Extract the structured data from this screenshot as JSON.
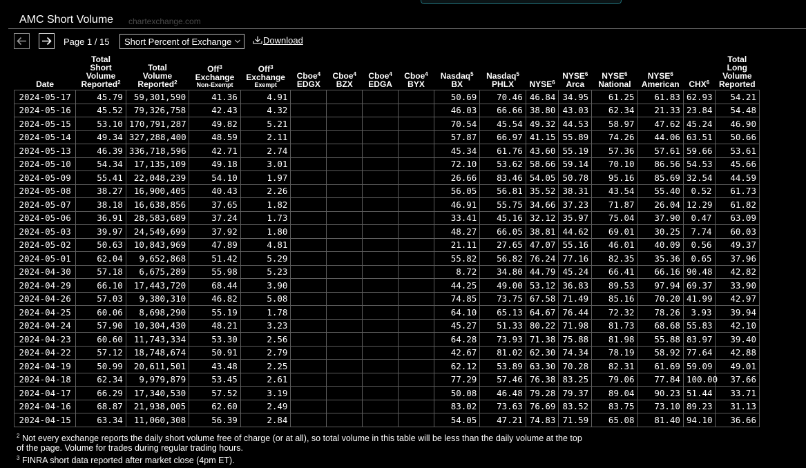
{
  "header": {
    "title": "AMC Short Volume",
    "watermark": "chartexchange.com"
  },
  "controls": {
    "page_label": "Page 1 / 15",
    "select_value": "Short Percent of Exchange",
    "download_label": "Download"
  },
  "columns": [
    {
      "lines": [
        "Total",
        "Short",
        "Volume",
        "Reported"
      ],
      "sup": "2",
      "small": ""
    },
    {
      "lines": [
        "Total",
        "Short",
        "Volume",
        "Reported"
      ],
      "sup": "2",
      "small": ""
    },
    {
      "lines": [
        "Off",
        "Exchange"
      ],
      "sup": "3",
      "small": "Non-Exempt"
    },
    {
      "lines": [
        "Off",
        "Exchange"
      ],
      "sup": "3",
      "small": "Exempt"
    },
    {
      "lines": [
        "Cboe",
        "EDGX"
      ],
      "sup": "4",
      "small": ""
    },
    {
      "lines": [
        "Cboe",
        "BZX"
      ],
      "sup": "4",
      "small": ""
    },
    {
      "lines": [
        "Cboe",
        "EDGA"
      ],
      "sup": "4",
      "small": ""
    },
    {
      "lines": [
        "Cboe",
        "BYX"
      ],
      "sup": "4",
      "small": ""
    },
    {
      "lines": [
        "Nasdaq",
        "BX"
      ],
      "sup": "5",
      "small": ""
    },
    {
      "lines": [
        "Nasdaq",
        "PHLX"
      ],
      "sup": "5",
      "small": ""
    },
    {
      "lines": [
        "NYSE"
      ],
      "sup": "6",
      "small": ""
    },
    {
      "lines": [
        "NYSE",
        "Arca"
      ],
      "sup": "6",
      "small": ""
    },
    {
      "lines": [
        "NYSE",
        "National"
      ],
      "sup": "6",
      "small": ""
    },
    {
      "lines": [
        "NYSE",
        "American"
      ],
      "sup": "6",
      "small": ""
    },
    {
      "lines": [
        "CHX"
      ],
      "sup": "6",
      "small": ""
    },
    {
      "lines": [
        "Total",
        "Long",
        "Volume",
        "Reported"
      ],
      "sup": "",
      "small": ""
    }
  ],
  "table_headers": {
    "date": "Date",
    "c1": [
      "Total",
      "Short",
      "Volume",
      "Reported"
    ],
    "c2": [
      "Total",
      "Volume",
      "Reported"
    ],
    "c3": [
      "Off",
      "Exchange",
      "Non-Exempt"
    ],
    "c4": [
      "Off",
      "Exchange",
      "Exempt"
    ],
    "c5": [
      "Cboe",
      "EDGX"
    ],
    "c6": [
      "Cboe",
      "BZX"
    ],
    "c7": [
      "Cboe",
      "EDGA"
    ],
    "c8": [
      "Cboe",
      "BYX"
    ],
    "c9": [
      "Nasdaq",
      "BX"
    ],
    "c10": [
      "Nasdaq",
      "PHLX"
    ],
    "c11": [
      "NYSE"
    ],
    "c12": [
      "NYSE",
      "Arca"
    ],
    "c13": [
      "NYSE",
      "National"
    ],
    "c14": [
      "NYSE",
      "American"
    ],
    "c15": [
      "CHX"
    ],
    "c16": [
      "Total",
      "Long",
      "Volume",
      "Reported"
    ]
  },
  "rows": [
    [
      "2024-05-17",
      "45.79",
      "59,301,590",
      "41.36",
      "4.91",
      "",
      "",
      "",
      "",
      "50.69",
      "70.46",
      "46.84",
      "34.95",
      "61.25",
      "61.83",
      "62.93",
      "54.21"
    ],
    [
      "2024-05-16",
      "45.52",
      "79,326,758",
      "42.43",
      "4.32",
      "",
      "",
      "",
      "",
      "46.03",
      "66.66",
      "38.80",
      "43.03",
      "62.34",
      "21.33",
      "23.84",
      "54.48"
    ],
    [
      "2024-05-15",
      "53.10",
      "170,791,287",
      "49.82",
      "5.21",
      "",
      "",
      "",
      "",
      "70.54",
      "45.54",
      "49.32",
      "44.53",
      "58.97",
      "47.62",
      "45.24",
      "46.90"
    ],
    [
      "2024-05-14",
      "49.34",
      "327,288,400",
      "48.59",
      "2.11",
      "",
      "",
      "",
      "",
      "57.87",
      "66.97",
      "41.15",
      "55.89",
      "74.26",
      "44.06",
      "63.51",
      "50.66"
    ],
    [
      "2024-05-13",
      "46.39",
      "336,718,596",
      "42.71",
      "2.74",
      "",
      "",
      "",
      "",
      "45.34",
      "61.76",
      "43.60",
      "55.19",
      "57.36",
      "57.61",
      "59.66",
      "53.61"
    ],
    [
      "2024-05-10",
      "54.34",
      "17,135,109",
      "49.18",
      "3.01",
      "",
      "",
      "",
      "",
      "72.10",
      "53.62",
      "58.66",
      "59.14",
      "70.10",
      "86.56",
      "54.53",
      "45.66"
    ],
    [
      "2024-05-09",
      "55.41",
      "22,048,239",
      "54.10",
      "1.97",
      "",
      "",
      "",
      "",
      "26.66",
      "83.46",
      "54.05",
      "50.78",
      "95.16",
      "85.69",
      "32.54",
      "44.59"
    ],
    [
      "2024-05-08",
      "38.27",
      "16,900,405",
      "40.43",
      "2.26",
      "",
      "",
      "",
      "",
      "56.05",
      "56.81",
      "35.52",
      "38.31",
      "43.54",
      "55.40",
      "0.52",
      "61.73"
    ],
    [
      "2024-05-07",
      "38.18",
      "16,638,856",
      "37.65",
      "1.82",
      "",
      "",
      "",
      "",
      "46.91",
      "55.75",
      "34.66",
      "37.23",
      "71.87",
      "26.04",
      "12.29",
      "61.82"
    ],
    [
      "2024-05-06",
      "36.91",
      "28,583,689",
      "37.24",
      "1.73",
      "",
      "",
      "",
      "",
      "33.41",
      "45.16",
      "32.12",
      "35.97",
      "75.04",
      "37.90",
      "0.47",
      "63.09"
    ],
    [
      "2024-05-03",
      "39.97",
      "24,549,699",
      "37.92",
      "1.80",
      "",
      "",
      "",
      "",
      "48.27",
      "66.05",
      "38.81",
      "44.62",
      "69.01",
      "30.25",
      "7.74",
      "60.03"
    ],
    [
      "2024-05-02",
      "50.63",
      "10,843,969",
      "47.89",
      "4.81",
      "",
      "",
      "",
      "",
      "21.11",
      "27.65",
      "47.07",
      "55.16",
      "46.01",
      "40.09",
      "0.56",
      "49.37"
    ],
    [
      "2024-05-01",
      "62.04",
      "9,652,868",
      "51.42",
      "5.29",
      "",
      "",
      "",
      "",
      "55.82",
      "56.82",
      "76.24",
      "77.16",
      "82.35",
      "35.36",
      "0.65",
      "37.96"
    ],
    [
      "2024-04-30",
      "57.18",
      "6,675,289",
      "55.98",
      "5.23",
      "",
      "",
      "",
      "",
      "8.72",
      "34.80",
      "44.79",
      "45.24",
      "66.41",
      "66.16",
      "90.48",
      "42.82"
    ],
    [
      "2024-04-29",
      "66.10",
      "17,443,720",
      "68.44",
      "3.90",
      "",
      "",
      "",
      "",
      "44.25",
      "49.00",
      "53.12",
      "36.83",
      "89.53",
      "97.94",
      "69.37",
      "33.90"
    ],
    [
      "2024-04-26",
      "57.03",
      "9,380,310",
      "46.82",
      "5.08",
      "",
      "",
      "",
      "",
      "74.85",
      "73.75",
      "67.58",
      "71.49",
      "85.16",
      "70.20",
      "41.99",
      "42.97"
    ],
    [
      "2024-04-25",
      "60.06",
      "8,698,290",
      "55.19",
      "1.78",
      "",
      "",
      "",
      "",
      "64.10",
      "65.13",
      "64.67",
      "76.44",
      "72.32",
      "78.26",
      "3.93",
      "39.94"
    ],
    [
      "2024-04-24",
      "57.90",
      "10,304,430",
      "48.21",
      "3.23",
      "",
      "",
      "",
      "",
      "45.27",
      "51.33",
      "80.22",
      "71.98",
      "81.73",
      "68.68",
      "55.83",
      "42.10"
    ],
    [
      "2024-04-23",
      "60.60",
      "11,743,334",
      "53.30",
      "2.56",
      "",
      "",
      "",
      "",
      "64.28",
      "73.93",
      "71.38",
      "75.88",
      "81.98",
      "55.88",
      "83.97",
      "39.40"
    ],
    [
      "2024-04-22",
      "57.12",
      "18,748,674",
      "50.91",
      "2.79",
      "",
      "",
      "",
      "",
      "42.67",
      "81.02",
      "62.30",
      "74.34",
      "78.19",
      "58.92",
      "77.64",
      "42.88"
    ],
    [
      "2024-04-19",
      "50.99",
      "20,611,501",
      "43.48",
      "2.25",
      "",
      "",
      "",
      "",
      "62.12",
      "53.89",
      "63.30",
      "70.28",
      "82.31",
      "61.69",
      "59.09",
      "49.01"
    ],
    [
      "2024-04-18",
      "62.34",
      "9,979,879",
      "53.45",
      "2.61",
      "",
      "",
      "",
      "",
      "77.29",
      "57.46",
      "76.38",
      "83.25",
      "79.06",
      "77.84",
      "100.00",
      "37.66"
    ],
    [
      "2024-04-17",
      "66.29",
      "17,340,530",
      "57.52",
      "3.19",
      "",
      "",
      "",
      "",
      "50.08",
      "46.48",
      "79.28",
      "79.37",
      "89.04",
      "90.23",
      "51.44",
      "33.71"
    ],
    [
      "2024-04-16",
      "68.87",
      "21,938,005",
      "62.60",
      "2.49",
      "",
      "",
      "",
      "",
      "83.02",
      "73.63",
      "76.69",
      "83.52",
      "83.75",
      "73.10",
      "89.23",
      "31.13"
    ],
    [
      "2024-04-15",
      "63.34",
      "11,060,308",
      "56.39",
      "2.84",
      "",
      "",
      "",
      "",
      "54.05",
      "47.21",
      "74.83",
      "71.59",
      "65.08",
      "81.40",
      "94.10",
      "36.66"
    ]
  ],
  "footnotes": {
    "note2": "Not every exchange reports the daily short volume free of charge (or at all), so total volume in this table will be less than the daily volume at the top of the page. Volume for trades during regular trading hours.",
    "note3": "FINRA short data reported after market close (4pm ET).",
    "note2_mark": "2",
    "note3_mark": "3"
  }
}
